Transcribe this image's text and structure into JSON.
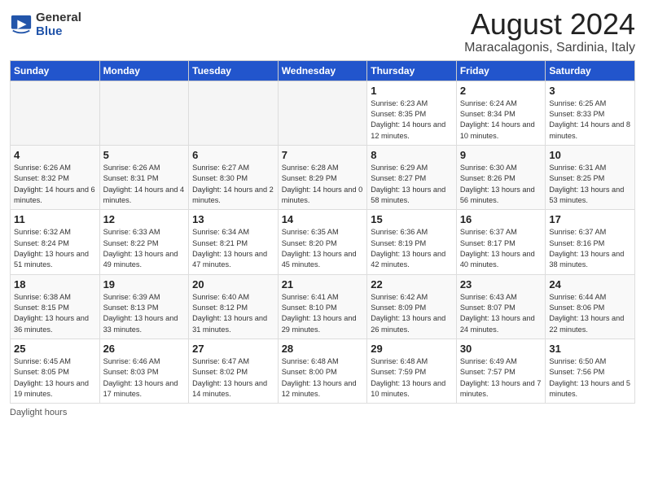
{
  "header": {
    "logo_general": "General",
    "logo_blue": "Blue",
    "month_title": "August 2024",
    "location": "Maracalagonis, Sardinia, Italy"
  },
  "days_of_week": [
    "Sunday",
    "Monday",
    "Tuesday",
    "Wednesday",
    "Thursday",
    "Friday",
    "Saturday"
  ],
  "weeks": [
    [
      {
        "day": "",
        "empty": true
      },
      {
        "day": "",
        "empty": true
      },
      {
        "day": "",
        "empty": true
      },
      {
        "day": "",
        "empty": true
      },
      {
        "day": "1",
        "sunrise": "6:23 AM",
        "sunset": "8:35 PM",
        "daylight": "14 hours and 12 minutes."
      },
      {
        "day": "2",
        "sunrise": "6:24 AM",
        "sunset": "8:34 PM",
        "daylight": "14 hours and 10 minutes."
      },
      {
        "day": "3",
        "sunrise": "6:25 AM",
        "sunset": "8:33 PM",
        "daylight": "14 hours and 8 minutes."
      }
    ],
    [
      {
        "day": "4",
        "sunrise": "6:26 AM",
        "sunset": "8:32 PM",
        "daylight": "14 hours and 6 minutes."
      },
      {
        "day": "5",
        "sunrise": "6:26 AM",
        "sunset": "8:31 PM",
        "daylight": "14 hours and 4 minutes."
      },
      {
        "day": "6",
        "sunrise": "6:27 AM",
        "sunset": "8:30 PM",
        "daylight": "14 hours and 2 minutes."
      },
      {
        "day": "7",
        "sunrise": "6:28 AM",
        "sunset": "8:29 PM",
        "daylight": "14 hours and 0 minutes."
      },
      {
        "day": "8",
        "sunrise": "6:29 AM",
        "sunset": "8:27 PM",
        "daylight": "13 hours and 58 minutes."
      },
      {
        "day": "9",
        "sunrise": "6:30 AM",
        "sunset": "8:26 PM",
        "daylight": "13 hours and 56 minutes."
      },
      {
        "day": "10",
        "sunrise": "6:31 AM",
        "sunset": "8:25 PM",
        "daylight": "13 hours and 53 minutes."
      }
    ],
    [
      {
        "day": "11",
        "sunrise": "6:32 AM",
        "sunset": "8:24 PM",
        "daylight": "13 hours and 51 minutes."
      },
      {
        "day": "12",
        "sunrise": "6:33 AM",
        "sunset": "8:22 PM",
        "daylight": "13 hours and 49 minutes."
      },
      {
        "day": "13",
        "sunrise": "6:34 AM",
        "sunset": "8:21 PM",
        "daylight": "13 hours and 47 minutes."
      },
      {
        "day": "14",
        "sunrise": "6:35 AM",
        "sunset": "8:20 PM",
        "daylight": "13 hours and 45 minutes."
      },
      {
        "day": "15",
        "sunrise": "6:36 AM",
        "sunset": "8:19 PM",
        "daylight": "13 hours and 42 minutes."
      },
      {
        "day": "16",
        "sunrise": "6:37 AM",
        "sunset": "8:17 PM",
        "daylight": "13 hours and 40 minutes."
      },
      {
        "day": "17",
        "sunrise": "6:37 AM",
        "sunset": "8:16 PM",
        "daylight": "13 hours and 38 minutes."
      }
    ],
    [
      {
        "day": "18",
        "sunrise": "6:38 AM",
        "sunset": "8:15 PM",
        "daylight": "13 hours and 36 minutes."
      },
      {
        "day": "19",
        "sunrise": "6:39 AM",
        "sunset": "8:13 PM",
        "daylight": "13 hours and 33 minutes."
      },
      {
        "day": "20",
        "sunrise": "6:40 AM",
        "sunset": "8:12 PM",
        "daylight": "13 hours and 31 minutes."
      },
      {
        "day": "21",
        "sunrise": "6:41 AM",
        "sunset": "8:10 PM",
        "daylight": "13 hours and 29 minutes."
      },
      {
        "day": "22",
        "sunrise": "6:42 AM",
        "sunset": "8:09 PM",
        "daylight": "13 hours and 26 minutes."
      },
      {
        "day": "23",
        "sunrise": "6:43 AM",
        "sunset": "8:07 PM",
        "daylight": "13 hours and 24 minutes."
      },
      {
        "day": "24",
        "sunrise": "6:44 AM",
        "sunset": "8:06 PM",
        "daylight": "13 hours and 22 minutes."
      }
    ],
    [
      {
        "day": "25",
        "sunrise": "6:45 AM",
        "sunset": "8:05 PM",
        "daylight": "13 hours and 19 minutes."
      },
      {
        "day": "26",
        "sunrise": "6:46 AM",
        "sunset": "8:03 PM",
        "daylight": "13 hours and 17 minutes."
      },
      {
        "day": "27",
        "sunrise": "6:47 AM",
        "sunset": "8:02 PM",
        "daylight": "13 hours and 14 minutes."
      },
      {
        "day": "28",
        "sunrise": "6:48 AM",
        "sunset": "8:00 PM",
        "daylight": "13 hours and 12 minutes."
      },
      {
        "day": "29",
        "sunrise": "6:48 AM",
        "sunset": "7:59 PM",
        "daylight": "13 hours and 10 minutes."
      },
      {
        "day": "30",
        "sunrise": "6:49 AM",
        "sunset": "7:57 PM",
        "daylight": "13 hours and 7 minutes."
      },
      {
        "day": "31",
        "sunrise": "6:50 AM",
        "sunset": "7:56 PM",
        "daylight": "13 hours and 5 minutes."
      }
    ]
  ],
  "footer": {
    "daylight_label": "Daylight hours"
  }
}
